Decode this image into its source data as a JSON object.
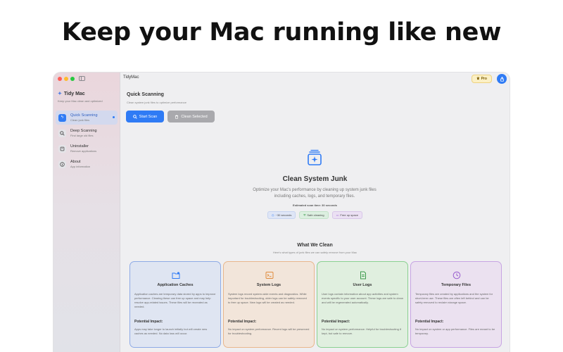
{
  "headline": "Keep your Mac running like new",
  "colors": {
    "accent": "#2f7bf5",
    "pro": "#fbf0c5"
  },
  "sidebar": {
    "app_name": "Tidy Mac",
    "app_subtitle": "Keep your Mac clean and optimized",
    "items": [
      {
        "label": "Quick Scanning",
        "sub": "Clean junk files",
        "icon": "bolt-icon",
        "active": true
      },
      {
        "label": "Deep Scanning",
        "sub": "Find large old files",
        "icon": "magnifier-icon",
        "active": false
      },
      {
        "label": "Uninstaller",
        "sub": "Remove applications",
        "icon": "trash-app-icon",
        "active": false
      },
      {
        "label": "About",
        "sub": "App information",
        "icon": "info-icon",
        "active": false
      }
    ]
  },
  "toolbar": {
    "title": "TidyMac",
    "pro_label": "Pro"
  },
  "main": {
    "title": "Quick Scanning",
    "subtitle": "Clean system junk files to optimize performance",
    "start_label": "Start Scan",
    "clean_label": "Clean Selected",
    "hero_title": "Clean System Junk",
    "hero_desc": "Optimize your Mac's performance by cleaning up system junk files including caches, logs, and temporary files.",
    "estimate": "Estimated scan time: 30 seconds",
    "chips": [
      "~30 seconds",
      "Safe cleaning",
      "Free up space"
    ],
    "what_title": "What We Clean",
    "what_sub": "Here's what types of junk files we can safely remove from your Mac",
    "impact_label": "Potential Impact:",
    "cards": [
      {
        "title": "Application Caches",
        "icon": "folder-badge-icon",
        "desc": "Application caches are temporary data stored by apps to improve performance. Clearing these can free up space and may help resolve app-related issues. These files will be recreated as needed.",
        "impact": "Apps may take longer to launch initially but will create new caches as needed. No data loss will occur."
      },
      {
        "title": "System Logs",
        "icon": "terminal-icon",
        "desc": "System logs record system-wide events and diagnostics. While important for troubleshooting, older logs can be safely removed to free up space. New logs will be created as needed.",
        "impact": "No impact on system performance. Recent logs will be preserved for troubleshooting."
      },
      {
        "title": "User Logs",
        "icon": "document-icon",
        "desc": "User logs contain information about app activities and system events specific to your user account. These logs are safe to clean and will be regenerated automatically.",
        "impact": "No impact on system performance. Helpful for troubleshooting if kept, but safe to remove."
      },
      {
        "title": "Temporary Files",
        "icon": "clock-icon",
        "desc": "Temporary files are created by applications and the system for short-term use. These files are often left behind and can be safely removed to reclaim storage space.",
        "impact": "No impact on system or app performance. Files are meant to be temporary."
      }
    ]
  }
}
